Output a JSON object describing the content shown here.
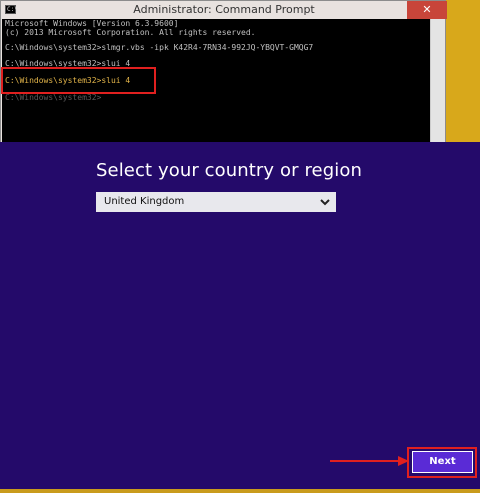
{
  "cmd_window": {
    "title": "Administrator: Command Prompt",
    "close_label": "✕",
    "lines": [
      "Microsoft Windows [Version 6.3.9600]",
      "(c) 2013 Microsoft Corporation. All rights reserved.",
      "",
      "C:\\Windows\\system32>slmgr.vbs -ipk K42R4-7RN34-992JQ-YBQVT-GMQG7",
      "",
      "C:\\Windows\\system32>slui 4",
      "",
      "C:\\Windows\\system32>slui 4",
      "",
      "C:\\Windows\\system32>"
    ]
  },
  "region_dialog": {
    "heading": "Select your country or region",
    "selected_country": "United Kingdom",
    "next_label": "Next"
  },
  "colors": {
    "panel": "#240a6a",
    "accent_button": "#5a2bd6",
    "annotation": "#e0201f"
  }
}
